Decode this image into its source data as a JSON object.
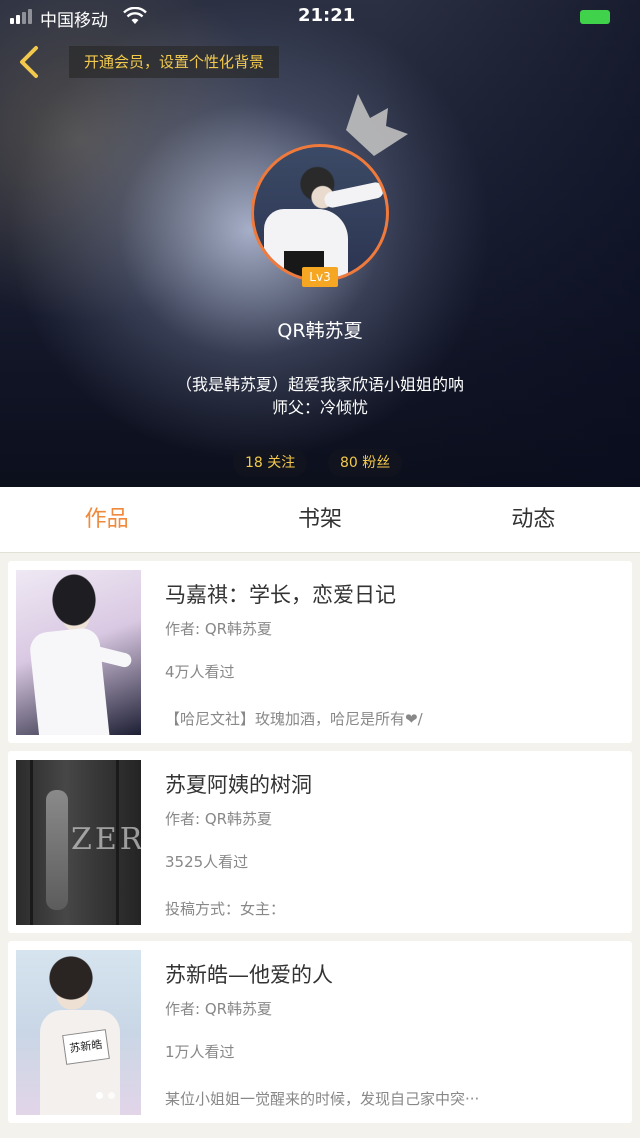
{
  "status_bar": {
    "carrier": "中国移动",
    "time": "21:21"
  },
  "header": {
    "vip_banner": "开通会员，设置个性化背景",
    "level_badge": "Lv3",
    "username": "QR韩苏夏",
    "bio_line1": "（我是韩苏夏）超爱我家欣语小姐姐的呐",
    "bio_line2": "师父：冷倾忧",
    "following": "18 关注",
    "fans": "80 粉丝",
    "colors": {
      "accent": "#f07a3c",
      "gold": "#f2c94c"
    }
  },
  "tabs": [
    {
      "label": "作品",
      "active": true
    },
    {
      "label": "书架",
      "active": false
    },
    {
      "label": "动态",
      "active": false
    }
  ],
  "works": [
    {
      "title": "马嘉祺：学长，恋爱日记",
      "author": "作者: QR韩苏夏",
      "views": "4万人看过",
      "desc": "【哈尼文社】玫瑰加酒，哈尼是所有❤/"
    },
    {
      "title": "苏夏阿姨的树洞",
      "author": "作者: QR韩苏夏",
      "views": "3525人看过",
      "desc": "投稿方式：女主："
    },
    {
      "title": "苏新皓—他爱的人",
      "author": "作者: QR韩苏夏",
      "views": "1万人看过",
      "desc": "某位小姐姐一觉醒来的时候，发现自己家中突···"
    }
  ],
  "cover_texts": {
    "cover2": "ZER",
    "cover3": "苏新皓"
  }
}
